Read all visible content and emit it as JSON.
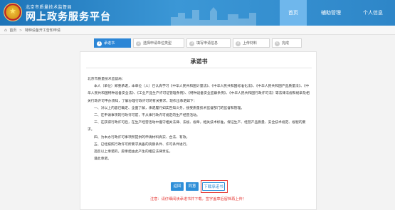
{
  "header": {
    "subtitle": "北京市质量技术监督局",
    "title": "网上政务服务平台",
    "nav": [
      "首页",
      "辅助管理",
      "个人信息"
    ]
  },
  "breadcrumb": {
    "home": "首页",
    "current": "特种设备开工告知申请"
  },
  "steps": [
    {
      "num": "1",
      "label": "承诺书"
    },
    {
      "num": "2",
      "label": "选择申请单位类型"
    },
    {
      "num": "3",
      "label": "填写申请信息"
    },
    {
      "num": "4",
      "label": "上传材料"
    },
    {
      "num": "5",
      "label": "完成"
    }
  ],
  "letter": {
    "title": "承诺书",
    "salutation": "北京市质量技术监督局：",
    "p1": "本人（单位）郑重承诺，本单位（人）已认真学习《中华人民共和国计量法》、《中华人民共和国标准化法》、《中华人民共和国产品质量法》、《中华人民共和国特种设备安全法》、《工业产品生产许可证管理条例》、《特种设备安全监察条例》、《中华人民共和国行政许可法》等法律法规和规章及相关行政许可申办须知，了解办理行政许可的有关要求，现作出承诺如下：",
    "i1": "一、对以上内容已确定、全面了解，承诺履行如实告知义务，接受质量技术监督部门的监督和管理。",
    "i2": "二、在申请事项的行政许可前，不从事行政许可规定的生产经营活动。",
    "i3": "三、在获得行政许可后，在生产经营活动中遵守相关法律、法规、规章，相关技术标准，保证生产、经营产品质量、安全技术规范、规程的要求。",
    "i4": "四、为本办行政许可事项所提供的申请材料真实、合法、有效。",
    "i5": "五、已经按照行政许可所要求具备的资质条件、许可条件进行。",
    "p2": "违反以上承诺的，愿承担由此产生的相应法律责任。",
    "closing": "谨此承诺。"
  },
  "buttons": {
    "back": "返回",
    "agree": "同意",
    "download": "下载承诺书"
  },
  "notice": "注意：请仔细阅读承诺书并下载，签字盖章后留档再上传！",
  "colors": {
    "header_blue": "#1d74b8",
    "active_step": "#2c86d6",
    "warning_red": "#e53935"
  }
}
